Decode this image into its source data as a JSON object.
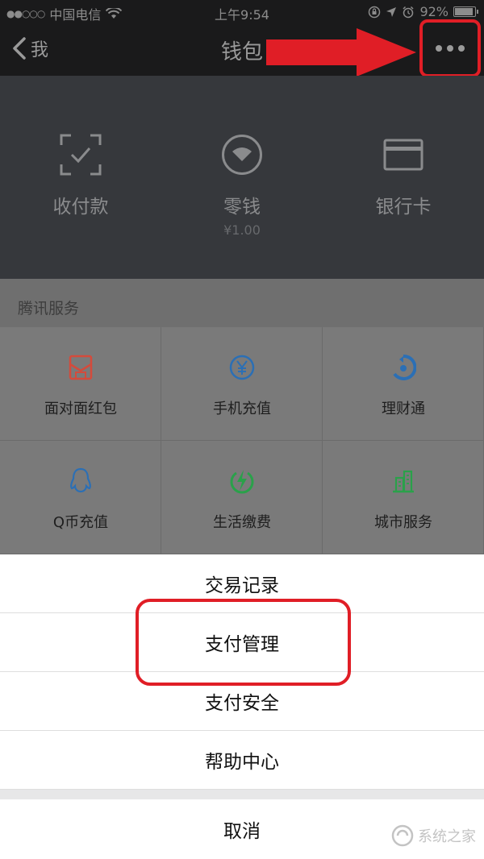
{
  "status_bar": {
    "carrier": "中国电信",
    "time": "上午9:54",
    "battery": "92%",
    "battery_level": 0.92
  },
  "nav": {
    "back_label": "我",
    "title": "钱包"
  },
  "wallet": [
    {
      "label": "收付款",
      "icon": "scan-pay-icon"
    },
    {
      "label": "零钱",
      "sub": "¥1.00",
      "icon": "change-icon"
    },
    {
      "label": "银行卡",
      "icon": "bank-card-icon"
    }
  ],
  "services": {
    "header": "腾讯服务",
    "items": [
      {
        "label": "面对面红包",
        "icon": "red-packet-icon",
        "color": "#d44b3c"
      },
      {
        "label": "手机充值",
        "icon": "yuan-circle-icon",
        "color": "#2b6fb5"
      },
      {
        "label": "理财通",
        "icon": "licaitong-icon",
        "color": "#2b6fb5"
      },
      {
        "label": "Q币充值",
        "icon": "penguin-icon",
        "color": "#2b6fb5"
      },
      {
        "label": "生活缴费",
        "icon": "lightning-icon",
        "color": "#2aa14a"
      },
      {
        "label": "城市服务",
        "icon": "city-icon",
        "color": "#2aa14a"
      }
    ]
  },
  "sheet": {
    "items": [
      "交易记录",
      "支付管理",
      "支付安全",
      "帮助中心"
    ],
    "cancel": "取消"
  },
  "watermark": {
    "text": "系统之家"
  },
  "colors": {
    "annotation_red": "#e01e26",
    "dark_bar": "#1a1a1b",
    "wallet_bg": "#36383c"
  }
}
